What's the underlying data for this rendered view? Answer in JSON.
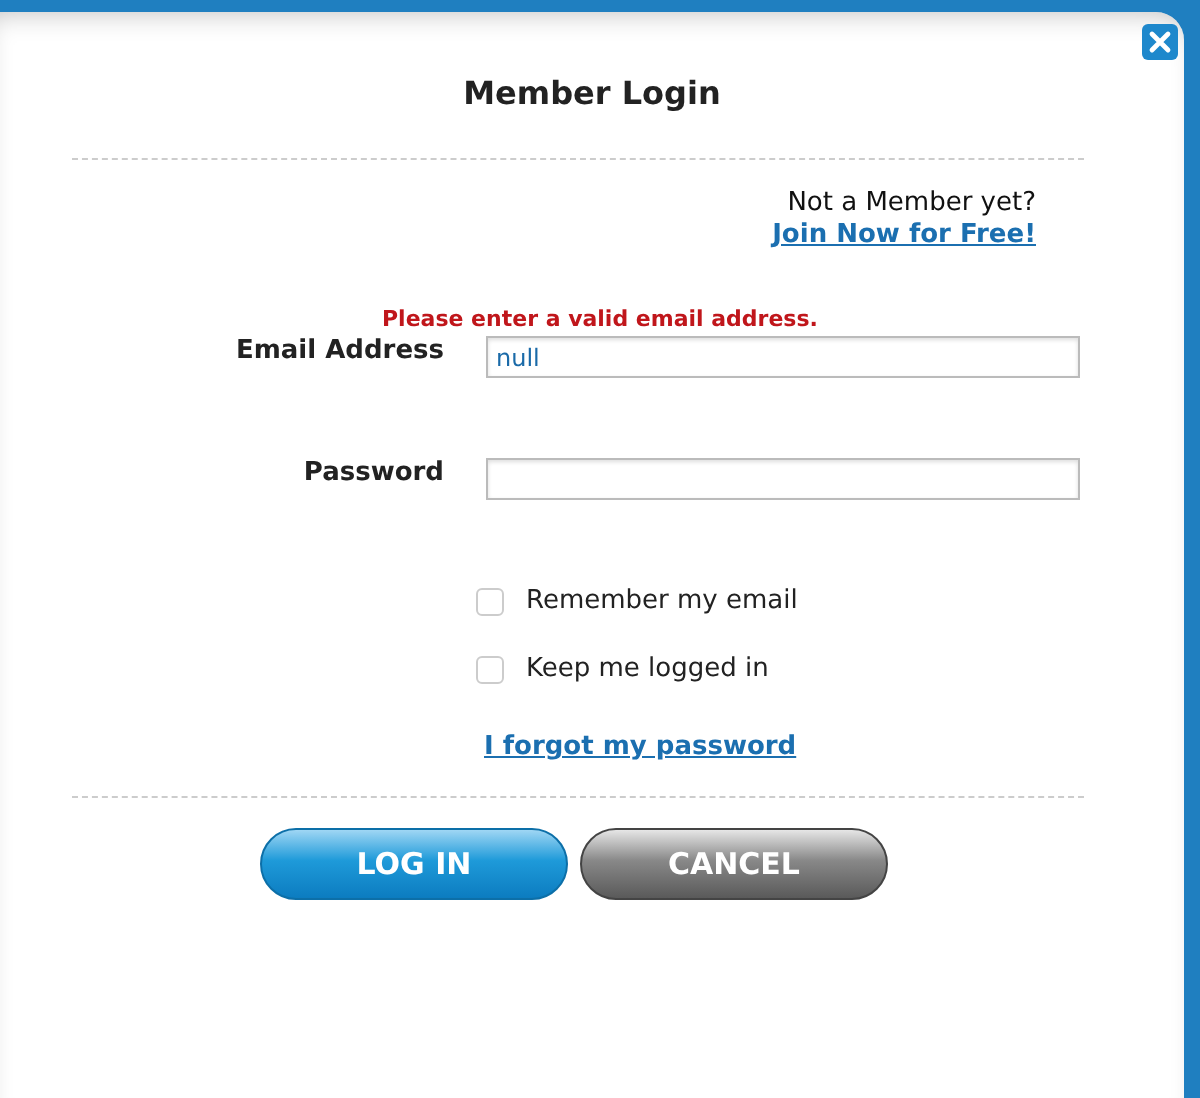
{
  "dialog": {
    "title": "Member Login"
  },
  "signup": {
    "prompt": "Not a Member yet?",
    "link": "Join Now for Free!"
  },
  "error": "Please enter a valid email address.",
  "fields": [
    {
      "label": "Email Address",
      "value": "null",
      "kind": "text"
    },
    {
      "label": "Password",
      "kind": "password"
    }
  ],
  "options": [
    {
      "label": "Remember my email",
      "checked": false
    },
    {
      "label": "Keep me logged in",
      "checked": false
    }
  ],
  "forgot_link": "I forgot my password",
  "buttons": [
    {
      "label": "LOG IN",
      "kind": "primary"
    },
    {
      "label": "CANCEL",
      "kind": "secondary"
    }
  ]
}
